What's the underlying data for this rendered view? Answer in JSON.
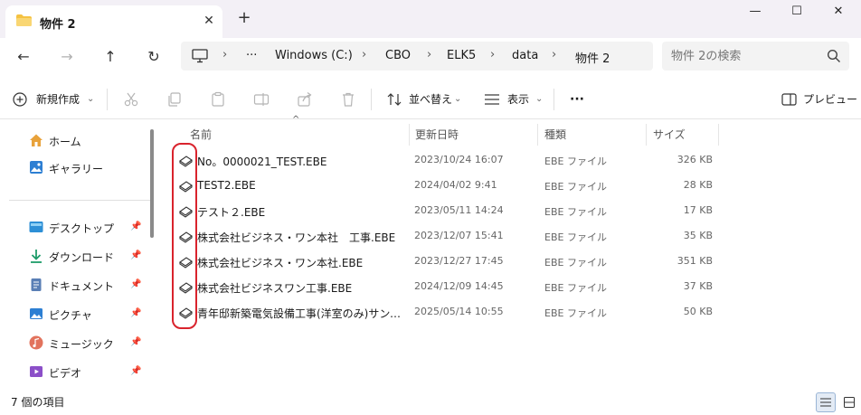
{
  "window": {
    "tab_title": "物件 2",
    "tab_close": "✕",
    "new_tab": "+",
    "minimize": "—",
    "maximize": "☐",
    "close": "✕"
  },
  "nav": {
    "back": "←",
    "forward": "→",
    "up": "↑",
    "refresh": "↻"
  },
  "address": {
    "overflow": "···",
    "crumbs": [
      "Windows (C:)",
      "CBO",
      "ELK5",
      "data",
      "物件 2"
    ],
    "separator": "›"
  },
  "search": {
    "placeholder": "物件 2の検索"
  },
  "toolbar": {
    "new_label": "新規作成",
    "sort_label": "並べ替え",
    "view_label": "表示",
    "more_label": "···",
    "preview_label": "プレビュー",
    "dropdown": "⌄"
  },
  "sidebar": {
    "items": [
      {
        "label": "ホーム",
        "icon": "home-icon"
      },
      {
        "label": "ギャラリー",
        "icon": "gallery-icon"
      },
      {
        "label": "デスクトップ",
        "icon": "desktop-icon",
        "pinned": true
      },
      {
        "label": "ダウンロード",
        "icon": "download-icon",
        "pinned": true
      },
      {
        "label": "ドキュメント",
        "icon": "document-icon",
        "pinned": true
      },
      {
        "label": "ピクチャ",
        "icon": "pictures-icon",
        "pinned": true
      },
      {
        "label": "ミュージック",
        "icon": "music-icon",
        "pinned": true
      },
      {
        "label": "ビデオ",
        "icon": "video-icon",
        "pinned": true
      }
    ]
  },
  "columns": {
    "name": "名前",
    "modified": "更新日時",
    "type": "種類",
    "size": "サイズ",
    "sort_arrow": "^"
  },
  "files": [
    {
      "name": "No。0000021_TEST.EBE",
      "modified": "2023/10/24 16:07",
      "type": "EBE ファイル",
      "size": "326 KB"
    },
    {
      "name": "TEST2.EBE",
      "modified": "2024/04/02 9:41",
      "type": "EBE ファイル",
      "size": "28 KB"
    },
    {
      "name": "テスト２.EBE",
      "modified": "2023/05/11 14:24",
      "type": "EBE ファイル",
      "size": "17 KB"
    },
    {
      "name": "株式会社ビジネス・ワン本社　工事.EBE",
      "modified": "2023/12/07 15:41",
      "type": "EBE ファイル",
      "size": "35 KB"
    },
    {
      "name": "株式会社ビジネス・ワン本社.EBE",
      "modified": "2023/12/27 17:45",
      "type": "EBE ファイル",
      "size": "351 KB"
    },
    {
      "name": "株式会社ビジネスワン工事.EBE",
      "modified": "2024/12/09 14:45",
      "type": "EBE ファイル",
      "size": "37 KB"
    },
    {
      "name": "青年邸新築電気設備工事(洋室のみ)サンプ...",
      "modified": "2025/05/14 10:55",
      "type": "EBE ファイル",
      "size": "50 KB"
    }
  ],
  "status": {
    "item_count": "7 個の項目"
  },
  "colors": {
    "highlight": "#d9232d",
    "folder": "#f5c242",
    "accent": "#0067c0"
  }
}
